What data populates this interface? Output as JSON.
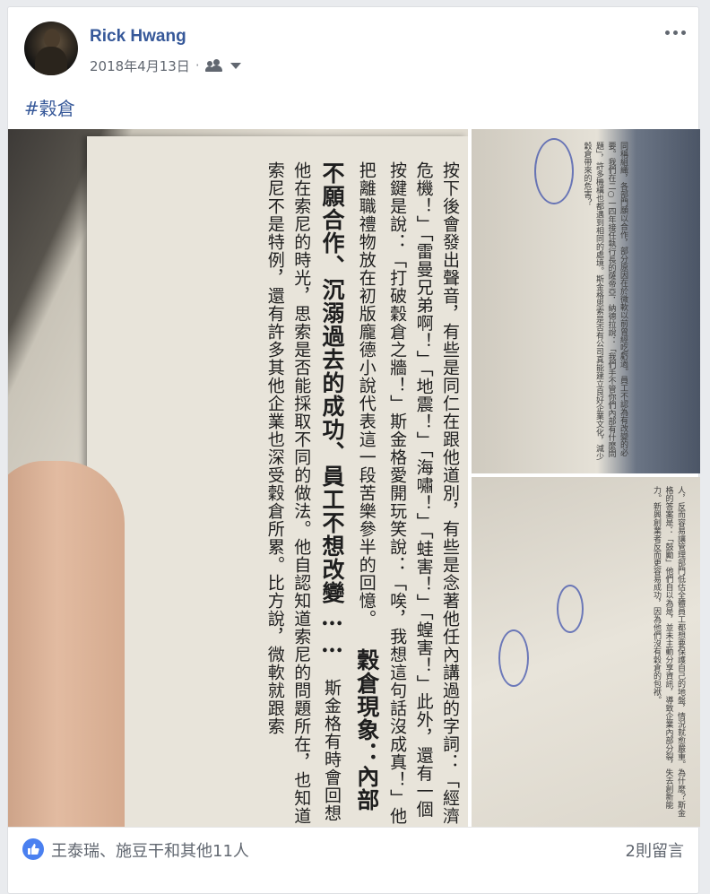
{
  "post": {
    "author": "Rick Hwang",
    "date": "2018年4月13日",
    "separator": "·",
    "hashtag": "#穀倉"
  },
  "photos": {
    "main_page_text": "按下後會發出聲音，有些是同仁在跟他道別，有些是念著他任內講過的字詞：「經濟危機！」「雷曼兄弟啊！」「地震！」「海嘯！」「蛙害！」「蝗害！」此外，還有一個按鍵是說：「打破穀倉之牆！」斯金格愛開玩笑說：「唉，我想這句話沒成真！」他把離職禮物放在初版龐德小說代表這一段苦樂參半的回憶。",
    "main_title": "穀倉現象：內部不願合作、沉溺過去的成功、員工不想改變……",
    "main_page_text2": "斯金格有時會回想他在索尼的時光，思索是否能採取不同的做法。他自認知道索尼的問題所在，也知道索尼不是特例，還有許多其他企業也深受穀倉所累。比方說，微軟就跟索",
    "side_top_text": "同稱組織，各部門願以合作，部分原因在於微軟以前曾經吃虧過。員工不認為有改變的必要。我們在二○一四年接任執行長的薩帝亞．納德拉說：「我們手不管你們內部有什麼問題」，許多機構也都遇到相同的處境。斯金格思索是否有公司真能建立良好企業文化，減少穀倉帶來的危害？",
    "side_bottom_text": "人，反而容易讓管理部門低估全體員工都想要保護自己的地盤，情況就愈嚴重。為什麼？斯金格的答案是：「鼓勵」他們自以為是，並未主動分享資訊，導致企業內部分裂，失去創新能力。新興創業者反而更容易成功，因為他們沒有穀倉的包袱。"
  },
  "footer": {
    "reactions_text": "王泰瑞、施豆干和其他11人",
    "comments_text": "2則留言"
  },
  "colors": {
    "link": "#365899",
    "secondary_text": "#616770",
    "like_blue": "#4a80f0",
    "background": "#e9ebee"
  },
  "icons": [
    "friends-audience-icon",
    "chevron-down-icon",
    "more-options-icon",
    "like-icon"
  ]
}
